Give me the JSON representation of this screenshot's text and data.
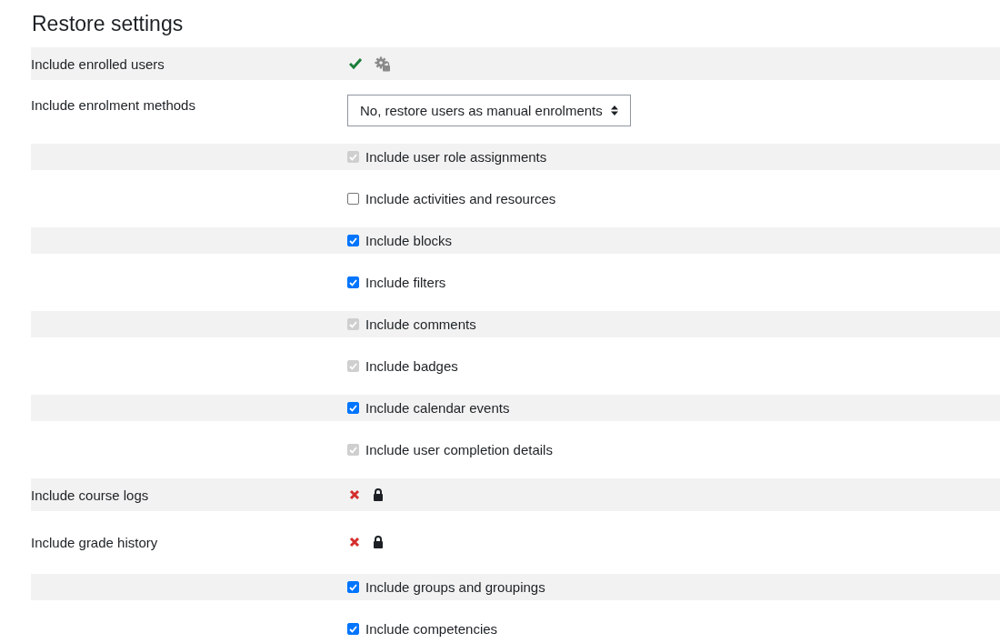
{
  "title": "Restore settings",
  "rows": [
    {
      "kind": "status",
      "label": "Include enrolled users",
      "included": true
    },
    {
      "kind": "select",
      "label": "Include enrolment methods",
      "value": "No, restore users as manual enrolments"
    },
    {
      "kind": "checkbox",
      "label": "Include user role assignments",
      "checked": true,
      "disabled": true
    },
    {
      "kind": "checkbox",
      "label": "Include activities and resources",
      "checked": false,
      "disabled": false
    },
    {
      "kind": "checkbox",
      "label": "Include blocks",
      "checked": true,
      "disabled": false
    },
    {
      "kind": "checkbox",
      "label": "Include filters",
      "checked": true,
      "disabled": false
    },
    {
      "kind": "checkbox",
      "label": "Include comments",
      "checked": true,
      "disabled": true
    },
    {
      "kind": "checkbox",
      "label": "Include badges",
      "checked": true,
      "disabled": true
    },
    {
      "kind": "checkbox",
      "label": "Include calendar events",
      "checked": true,
      "disabled": false
    },
    {
      "kind": "checkbox",
      "label": "Include user completion details",
      "checked": true,
      "disabled": true
    },
    {
      "kind": "locked",
      "label": "Include course logs",
      "included": false
    },
    {
      "kind": "locked",
      "label": "Include grade history",
      "included": false
    },
    {
      "kind": "checkbox",
      "label": "Include groups and groupings",
      "checked": true,
      "disabled": false
    },
    {
      "kind": "checkbox",
      "label": "Include competencies",
      "checked": true,
      "disabled": false
    }
  ]
}
